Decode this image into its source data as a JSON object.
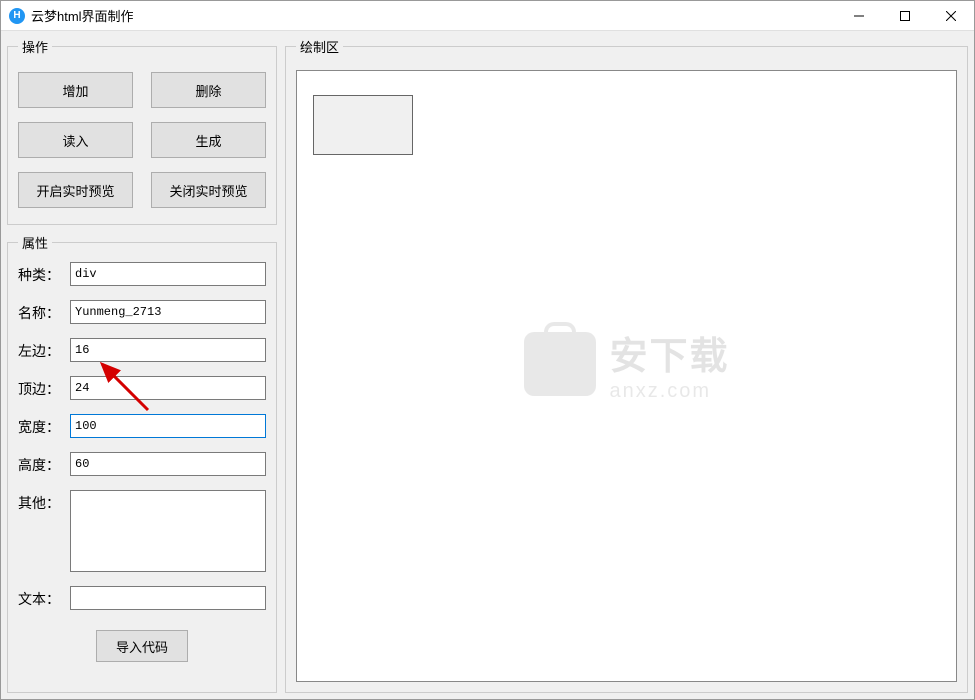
{
  "window": {
    "title": "云梦html界面制作",
    "icon_letter": "H"
  },
  "operations": {
    "legend": "操作",
    "buttons": {
      "add": "增加",
      "delete": "删除",
      "load": "读入",
      "generate": "生成",
      "enable_preview": "开启实时预览",
      "disable_preview": "关闭实时预览"
    }
  },
  "properties": {
    "legend": "属性",
    "labels": {
      "type": "种类：",
      "name": "名称：",
      "left": "左边：",
      "top": "顶边：",
      "width": "宽度：",
      "height": "高度：",
      "other": "其他：",
      "text": "文本："
    },
    "values": {
      "type": "div",
      "name": "Yunmeng_2713",
      "left": "16",
      "top": "24",
      "width": "100",
      "height": "60",
      "other": "",
      "text": ""
    },
    "import_button": "导入代码"
  },
  "canvas": {
    "legend": "绘制区"
  },
  "watermark": {
    "main": "安下载",
    "sub": "anxz.com"
  }
}
